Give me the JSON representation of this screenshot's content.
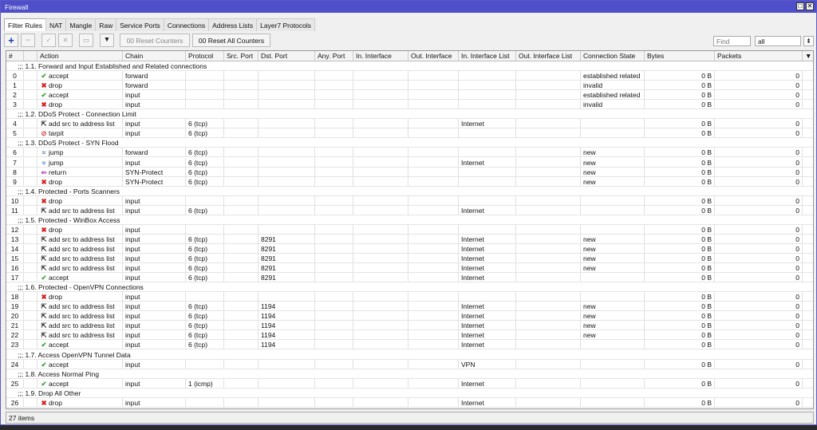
{
  "window": {
    "title": "Firewall"
  },
  "tabs": [
    "Filter Rules",
    "NAT",
    "Mangle",
    "Raw",
    "Service Ports",
    "Connections",
    "Address Lists",
    "Layer7 Protocols"
  ],
  "toolbar": {
    "reset_counters": "00 Reset Counters",
    "reset_all_counters": "00 Reset All Counters",
    "find_placeholder": "Find",
    "filter_value": "all"
  },
  "columns": [
    "#",
    "",
    "Action",
    "Chain",
    "Protocol",
    "Src. Port",
    "Dst. Port",
    "Any. Port",
    "In. Interface",
    "Out. Interface",
    "In. Interface List",
    "Out. Interface List",
    "Connection State",
    "Bytes",
    "Packets"
  ],
  "rows": [
    {
      "comment": ";;; 1.1. Forward and Input Established and Related connections"
    },
    {
      "n": "0",
      "action": "accept",
      "chain": "forward",
      "proto": "",
      "dport": "",
      "inlist": "",
      "state": "established related",
      "bytes": "0 B",
      "packets": "0"
    },
    {
      "n": "1",
      "action": "drop",
      "chain": "forward",
      "proto": "",
      "dport": "",
      "inlist": "",
      "state": "invalid",
      "bytes": "0 B",
      "packets": "0"
    },
    {
      "n": "2",
      "action": "accept",
      "chain": "input",
      "proto": "",
      "dport": "",
      "inlist": "",
      "state": "established related",
      "bytes": "0 B",
      "packets": "0"
    },
    {
      "n": "3",
      "action": "drop",
      "chain": "input",
      "proto": "",
      "dport": "",
      "inlist": "",
      "state": "invalid",
      "bytes": "0 B",
      "packets": "0"
    },
    {
      "comment": ";;; 1.2. DDoS Protect - Connection Limit"
    },
    {
      "n": "4",
      "action": "add src to address list",
      "chain": "input",
      "proto": "6 (tcp)",
      "dport": "",
      "inlist": "Internet",
      "state": "",
      "bytes": "0 B",
      "packets": "0"
    },
    {
      "n": "5",
      "action": "tarpit",
      "chain": "input",
      "proto": "6 (tcp)",
      "dport": "",
      "inlist": "",
      "state": "",
      "bytes": "0 B",
      "packets": "0"
    },
    {
      "comment": ";;; 1.3. DDoS Protect - SYN Flood"
    },
    {
      "n": "6",
      "action": "jump",
      "chain": "forward",
      "proto": "6 (tcp)",
      "dport": "",
      "inlist": "",
      "state": "new",
      "bytes": "0 B",
      "packets": "0"
    },
    {
      "n": "7",
      "action": "jump",
      "chain": "input",
      "proto": "6 (tcp)",
      "dport": "",
      "inlist": "Internet",
      "state": "new",
      "bytes": "0 B",
      "packets": "0"
    },
    {
      "n": "8",
      "action": "return",
      "chain": "SYN-Protect",
      "proto": "6 (tcp)",
      "dport": "",
      "inlist": "",
      "state": "new",
      "bytes": "0 B",
      "packets": "0"
    },
    {
      "n": "9",
      "action": "drop",
      "chain": "SYN-Protect",
      "proto": "6 (tcp)",
      "dport": "",
      "inlist": "",
      "state": "new",
      "bytes": "0 B",
      "packets": "0"
    },
    {
      "comment": ";;; 1.4. Protected - Ports Scanners"
    },
    {
      "n": "10",
      "action": "drop",
      "chain": "input",
      "proto": "",
      "dport": "",
      "inlist": "",
      "state": "",
      "bytes": "0 B",
      "packets": "0"
    },
    {
      "n": "11",
      "action": "add src to address list",
      "chain": "input",
      "proto": "6 (tcp)",
      "dport": "",
      "inlist": "Internet",
      "state": "",
      "bytes": "0 B",
      "packets": "0"
    },
    {
      "comment": ";;; 1.5. Protected - WinBox Access"
    },
    {
      "n": "12",
      "action": "drop",
      "chain": "input",
      "proto": "",
      "dport": "",
      "inlist": "",
      "state": "",
      "bytes": "0 B",
      "packets": "0"
    },
    {
      "n": "13",
      "action": "add src to address list",
      "chain": "input",
      "proto": "6 (tcp)",
      "dport": "8291",
      "inlist": "Internet",
      "state": "new",
      "bytes": "0 B",
      "packets": "0"
    },
    {
      "n": "14",
      "action": "add src to address list",
      "chain": "input",
      "proto": "6 (tcp)",
      "dport": "8291",
      "inlist": "Internet",
      "state": "new",
      "bytes": "0 B",
      "packets": "0"
    },
    {
      "n": "15",
      "action": "add src to address list",
      "chain": "input",
      "proto": "6 (tcp)",
      "dport": "8291",
      "inlist": "Internet",
      "state": "new",
      "bytes": "0 B",
      "packets": "0"
    },
    {
      "n": "16",
      "action": "add src to address list",
      "chain": "input",
      "proto": "6 (tcp)",
      "dport": "8291",
      "inlist": "Internet",
      "state": "new",
      "bytes": "0 B",
      "packets": "0"
    },
    {
      "n": "17",
      "action": "accept",
      "chain": "input",
      "proto": "6 (tcp)",
      "dport": "8291",
      "inlist": "Internet",
      "state": "",
      "bytes": "0 B",
      "packets": "0"
    },
    {
      "comment": ";;; 1.6. Protected - OpenVPN Connections"
    },
    {
      "n": "18",
      "action": "drop",
      "chain": "input",
      "proto": "",
      "dport": "",
      "inlist": "",
      "state": "",
      "bytes": "0 B",
      "packets": "0"
    },
    {
      "n": "19",
      "action": "add src to address list",
      "chain": "input",
      "proto": "6 (tcp)",
      "dport": "1194",
      "inlist": "Internet",
      "state": "new",
      "bytes": "0 B",
      "packets": "0"
    },
    {
      "n": "20",
      "action": "add src to address list",
      "chain": "input",
      "proto": "6 (tcp)",
      "dport": "1194",
      "inlist": "Internet",
      "state": "new",
      "bytes": "0 B",
      "packets": "0"
    },
    {
      "n": "21",
      "action": "add src to address list",
      "chain": "input",
      "proto": "6 (tcp)",
      "dport": "1194",
      "inlist": "Internet",
      "state": "new",
      "bytes": "0 B",
      "packets": "0"
    },
    {
      "n": "22",
      "action": "add src to address list",
      "chain": "input",
      "proto": "6 (tcp)",
      "dport": "1194",
      "inlist": "Internet",
      "state": "new",
      "bytes": "0 B",
      "packets": "0"
    },
    {
      "n": "23",
      "action": "accept",
      "chain": "input",
      "proto": "6 (tcp)",
      "dport": "1194",
      "inlist": "Internet",
      "state": "",
      "bytes": "0 B",
      "packets": "0"
    },
    {
      "comment": ";;; 1.7. Access OpenVPN Tunnel Data"
    },
    {
      "n": "24",
      "action": "accept",
      "chain": "input",
      "proto": "",
      "dport": "",
      "inlist": "VPN",
      "state": "",
      "bytes": "0 B",
      "packets": "0"
    },
    {
      "comment": ";;; 1.8. Access Normal Ping"
    },
    {
      "n": "25",
      "action": "accept",
      "chain": "input",
      "proto": "1 (icmp)",
      "dport": "",
      "inlist": "Internet",
      "state": "",
      "bytes": "0 B",
      "packets": "0"
    },
    {
      "comment": ";;; 1.9. Drop All Other"
    },
    {
      "n": "26",
      "action": "drop",
      "chain": "input",
      "proto": "",
      "dport": "",
      "inlist": "Internet",
      "state": "",
      "bytes": "0 B",
      "packets": "0"
    }
  ],
  "status": {
    "items": "27 items"
  },
  "icons": {
    "accept": "check-icon",
    "drop": "x-icon",
    "add src to address list": "add-to-list-icon",
    "tarpit": "tarpit-icon",
    "jump": "jump-icon",
    "return": "return-icon"
  },
  "colors": {
    "titlebar": "#4f4fc9",
    "accept": "#3aa83a",
    "drop": "#d22222",
    "jump": "#4a6fc0",
    "return": "#b03ab0"
  }
}
